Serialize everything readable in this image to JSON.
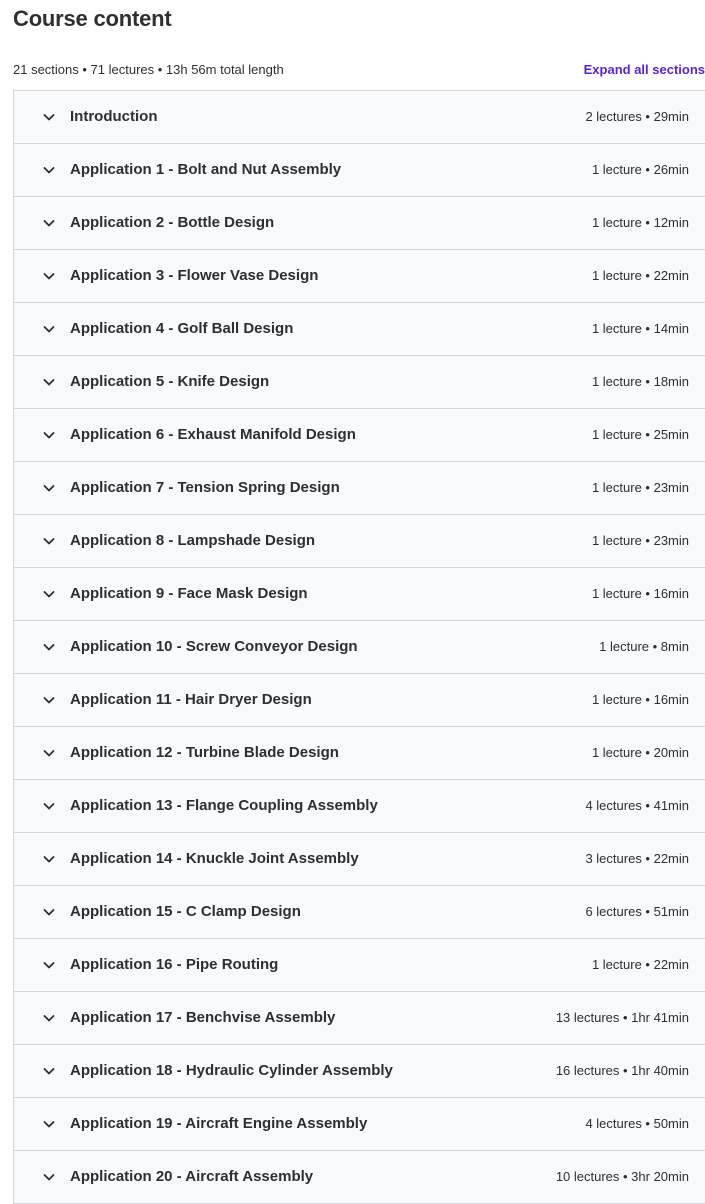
{
  "header": {
    "title": "Course content",
    "summary": "21 sections • 71 lectures • 13h 56m total length",
    "expand_all_label": "Expand all sections"
  },
  "sections": [
    {
      "title": "Introduction",
      "meta": "2 lectures • 29min"
    },
    {
      "title": "Application 1 - Bolt and Nut Assembly",
      "meta": "1 lecture • 26min"
    },
    {
      "title": "Application 2 - Bottle Design",
      "meta": "1 lecture • 12min"
    },
    {
      "title": "Application 3 - Flower Vase Design",
      "meta": "1 lecture • 22min"
    },
    {
      "title": "Application 4 - Golf Ball Design",
      "meta": "1 lecture • 14min"
    },
    {
      "title": "Application 5 - Knife Design",
      "meta": "1 lecture • 18min"
    },
    {
      "title": "Application 6 - Exhaust Manifold Design",
      "meta": "1 lecture • 25min"
    },
    {
      "title": "Application 7 - Tension Spring Design",
      "meta": "1 lecture • 23min"
    },
    {
      "title": "Application 8 - Lampshade Design",
      "meta": "1 lecture • 23min"
    },
    {
      "title": "Application 9 - Face Mask Design",
      "meta": "1 lecture • 16min"
    },
    {
      "title": "Application 10 - Screw Conveyor Design",
      "meta": "1 lecture • 8min"
    },
    {
      "title": "Application 11 - Hair Dryer Design",
      "meta": "1 lecture • 16min"
    },
    {
      "title": "Application 12 - Turbine Blade Design",
      "meta": "1 lecture • 20min"
    },
    {
      "title": "Application 13 - Flange Coupling Assembly",
      "meta": "4 lectures • 41min"
    },
    {
      "title": "Application 14 - Knuckle Joint Assembly",
      "meta": "3 lectures • 22min"
    },
    {
      "title": "Application 15 - C Clamp Design",
      "meta": "6 lectures • 51min"
    },
    {
      "title": "Application 16 - Pipe Routing",
      "meta": "1 lecture • 22min"
    },
    {
      "title": "Application 17 - Benchvise Assembly",
      "meta": "13 lectures • 1hr 41min"
    },
    {
      "title": "Application 18 - Hydraulic Cylinder Assembly",
      "meta": "16 lectures • 1hr 40min"
    },
    {
      "title": "Application 19 - Aircraft Engine Assembly",
      "meta": "4 lectures • 50min"
    },
    {
      "title": "Application 20 - Aircraft Assembly",
      "meta": "10 lectures • 3hr 20min"
    }
  ],
  "icons": {
    "section_toggle": "chevron-down-icon"
  },
  "colors": {
    "accent": "#5624d0",
    "text": "#2d2f31",
    "row_background": "#f7f9fa",
    "border": "#d1d7dc"
  }
}
